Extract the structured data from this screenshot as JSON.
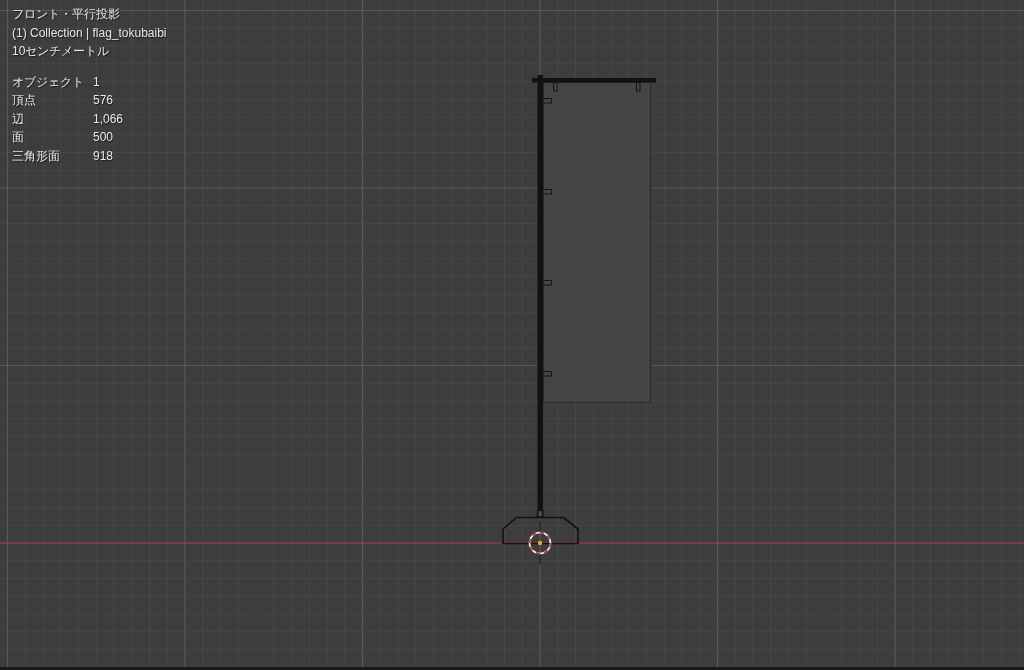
{
  "viewport": {
    "view_name": "フロント・平行投影",
    "collection_info": "(1) Collection | flag_tokubaibi",
    "grid_scale": "10センチメートル",
    "statistics": [
      {
        "label": "オブジェクト",
        "value": "1"
      },
      {
        "label": "頂点",
        "value": "576"
      },
      {
        "label": "辺",
        "value": "1,066"
      },
      {
        "label": "面",
        "value": "500"
      },
      {
        "label": "三角形面",
        "value": "918"
      }
    ]
  }
}
